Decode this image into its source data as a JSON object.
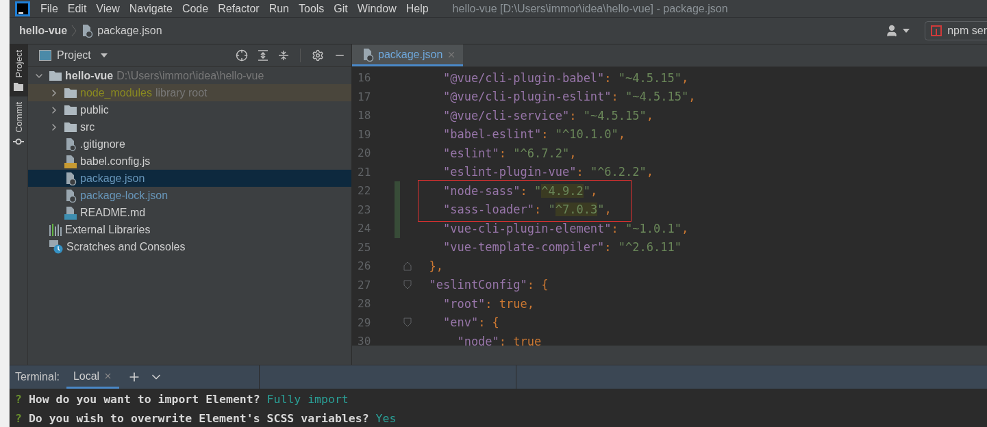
{
  "window": {
    "title": "hello-vue [D:\\Users\\immor\\idea\\hello-vue] - package.json"
  },
  "menu": [
    "File",
    "Edit",
    "View",
    "Navigate",
    "Code",
    "Refactor",
    "Run",
    "Tools",
    "Git",
    "Window",
    "Help"
  ],
  "breadcrumb": [
    "hello-vue",
    "package.json"
  ],
  "run_config": {
    "label": "npm ser"
  },
  "side_tabs": [
    {
      "label": "Project",
      "selected": true
    },
    {
      "label": "Commit",
      "selected": false
    }
  ],
  "project_panel": {
    "title": "Project",
    "tree": [
      {
        "label": "hello-vue",
        "hint": "D:\\Users\\immor\\idea\\hello-vue",
        "kind": "folder",
        "expanded": true,
        "selected": false,
        "library": false,
        "modified": false,
        "children": [
          {
            "label": "node_modules",
            "hint": "library root",
            "kind": "folder",
            "expanded": false,
            "selected": false,
            "library": true,
            "modified": false
          },
          {
            "label": "public",
            "kind": "folder",
            "expanded": false,
            "selected": false,
            "library": false,
            "modified": false
          },
          {
            "label": "src",
            "kind": "folder",
            "expanded": false,
            "selected": false,
            "library": false,
            "modified": false
          },
          {
            "label": ".gitignore",
            "kind": "ignore",
            "selected": false,
            "library": false,
            "modified": false
          },
          {
            "label": "babel.config.js",
            "kind": "js",
            "selected": false,
            "library": false,
            "modified": false
          },
          {
            "label": "package.json",
            "kind": "json",
            "selected": true,
            "library": false,
            "modified": true
          },
          {
            "label": "package-lock.json",
            "kind": "json",
            "selected": false,
            "library": false,
            "modified": true
          },
          {
            "label": "README.md",
            "kind": "md",
            "selected": false,
            "library": false,
            "modified": false
          }
        ]
      },
      {
        "label": "External Libraries",
        "kind": "libraries",
        "selected": false,
        "library": false,
        "modified": false
      },
      {
        "label": "Scratches and Consoles",
        "kind": "scratches",
        "selected": false,
        "library": false,
        "modified": false
      }
    ]
  },
  "editor": {
    "tabs": [
      {
        "label": "package.json",
        "selected": true
      }
    ],
    "lines": [
      {
        "number": "16",
        "changed": false,
        "boxed": false,
        "fold_start": false,
        "fold_end": false,
        "tokens": [
          {
            "kind": "key",
            "text": "    \"@vue/cli-plugin-babel\""
          },
          {
            "kind": "punct",
            "text": ": "
          },
          {
            "kind": "str",
            "text": "\"~4.5.15\"",
            "highlighted": false
          },
          {
            "kind": "punct",
            "text": ","
          }
        ]
      },
      {
        "number": "17",
        "changed": false,
        "boxed": false,
        "fold_start": false,
        "fold_end": false,
        "tokens": [
          {
            "kind": "key",
            "text": "    \"@vue/cli-plugin-eslint\""
          },
          {
            "kind": "punct",
            "text": ": "
          },
          {
            "kind": "str",
            "text": "\"~4.5.15\"",
            "highlighted": false
          },
          {
            "kind": "punct",
            "text": ","
          }
        ]
      },
      {
        "number": "18",
        "changed": false,
        "boxed": false,
        "fold_start": false,
        "fold_end": false,
        "tokens": [
          {
            "kind": "key",
            "text": "    \"@vue/cli-service\""
          },
          {
            "kind": "punct",
            "text": ": "
          },
          {
            "kind": "str",
            "text": "\"~4.5.15\"",
            "highlighted": false
          },
          {
            "kind": "punct",
            "text": ","
          }
        ]
      },
      {
        "number": "19",
        "changed": false,
        "boxed": false,
        "fold_start": false,
        "fold_end": false,
        "tokens": [
          {
            "kind": "key",
            "text": "    \"babel-eslint\""
          },
          {
            "kind": "punct",
            "text": ": "
          },
          {
            "kind": "str",
            "text": "\"^10.1.0\"",
            "highlighted": false
          },
          {
            "kind": "punct",
            "text": ","
          }
        ]
      },
      {
        "number": "20",
        "changed": false,
        "boxed": false,
        "fold_start": false,
        "fold_end": false,
        "tokens": [
          {
            "kind": "key",
            "text": "    \"eslint\""
          },
          {
            "kind": "punct",
            "text": ": "
          },
          {
            "kind": "str",
            "text": "\"^6.7.2\"",
            "highlighted": false
          },
          {
            "kind": "punct",
            "text": ","
          }
        ]
      },
      {
        "number": "21",
        "changed": false,
        "boxed": false,
        "fold_start": false,
        "fold_end": false,
        "tokens": [
          {
            "kind": "key",
            "text": "    \"eslint-plugin-vue\""
          },
          {
            "kind": "punct",
            "text": ": "
          },
          {
            "kind": "str",
            "text": "\"^6.2.2\"",
            "highlighted": false
          },
          {
            "kind": "punct",
            "text": ","
          }
        ]
      },
      {
        "number": "22",
        "changed": true,
        "boxed": true,
        "fold_start": false,
        "fold_end": false,
        "tokens": [
          {
            "kind": "key",
            "text": "    \"node-sass\""
          },
          {
            "kind": "punct",
            "text": ": "
          },
          {
            "kind": "str",
            "text": "\"",
            "highlighted": false
          },
          {
            "kind": "str",
            "text": "^4.9.2",
            "highlighted": true
          },
          {
            "kind": "str",
            "text": "\"",
            "highlighted": false
          },
          {
            "kind": "punct",
            "text": ","
          }
        ]
      },
      {
        "number": "23",
        "changed": true,
        "boxed": true,
        "fold_start": false,
        "fold_end": false,
        "tokens": [
          {
            "kind": "key",
            "text": "    \"sass-loader\""
          },
          {
            "kind": "punct",
            "text": ": "
          },
          {
            "kind": "str",
            "text": "\"",
            "highlighted": false
          },
          {
            "kind": "str",
            "text": "^7.0.3",
            "highlighted": true
          },
          {
            "kind": "str",
            "text": "\"",
            "highlighted": false
          },
          {
            "kind": "punct",
            "text": ","
          }
        ]
      },
      {
        "number": "24",
        "changed": true,
        "boxed": false,
        "fold_start": false,
        "fold_end": false,
        "tokens": [
          {
            "kind": "key",
            "text": "    \"vue-cli-plugin-element\""
          },
          {
            "kind": "punct",
            "text": ": "
          },
          {
            "kind": "str",
            "text": "\"~1.0.1\"",
            "highlighted": false
          },
          {
            "kind": "punct",
            "text": ","
          }
        ]
      },
      {
        "number": "25",
        "changed": false,
        "boxed": false,
        "fold_start": false,
        "fold_end": false,
        "tokens": [
          {
            "kind": "key",
            "text": "    \"vue-template-compiler\""
          },
          {
            "kind": "punct",
            "text": ": "
          },
          {
            "kind": "str",
            "text": "\"^2.6.11\"",
            "highlighted": false
          }
        ]
      },
      {
        "number": "26",
        "changed": false,
        "boxed": false,
        "fold_start": false,
        "fold_end": true,
        "tokens": [
          {
            "kind": "punct",
            "text": "  },"
          }
        ]
      },
      {
        "number": "27",
        "changed": false,
        "boxed": false,
        "fold_start": true,
        "fold_end": false,
        "tokens": [
          {
            "kind": "key",
            "text": "  \"eslintConfig\""
          },
          {
            "kind": "punct",
            "text": ": {"
          }
        ]
      },
      {
        "number": "28",
        "changed": false,
        "boxed": false,
        "fold_start": false,
        "fold_end": false,
        "tokens": [
          {
            "kind": "key",
            "text": "    \"root\""
          },
          {
            "kind": "punct",
            "text": ": "
          },
          {
            "kind": "bool",
            "text": "true"
          },
          {
            "kind": "punct",
            "text": ","
          }
        ]
      },
      {
        "number": "29",
        "changed": false,
        "boxed": false,
        "fold_start": true,
        "fold_end": false,
        "tokens": [
          {
            "kind": "key",
            "text": "    \"env\""
          },
          {
            "kind": "punct",
            "text": ": {"
          }
        ]
      },
      {
        "number": "30",
        "changed": false,
        "boxed": false,
        "fold_start": false,
        "fold_end": false,
        "tokens": [
          {
            "kind": "key",
            "text": "      \"node\""
          },
          {
            "kind": "punct",
            "text": ": "
          },
          {
            "kind": "bool",
            "text": "true"
          }
        ]
      }
    ]
  },
  "terminal": {
    "label": "Terminal:",
    "tabs": [
      {
        "label": "Local",
        "selected": true
      }
    ],
    "lines": [
      {
        "prompt": "?",
        "question": "How do you want to import Element?",
        "answer": "Fully import"
      },
      {
        "prompt": "?",
        "question": "Do you wish to overwrite Element's SCSS variables?",
        "answer": "Yes"
      }
    ]
  }
}
